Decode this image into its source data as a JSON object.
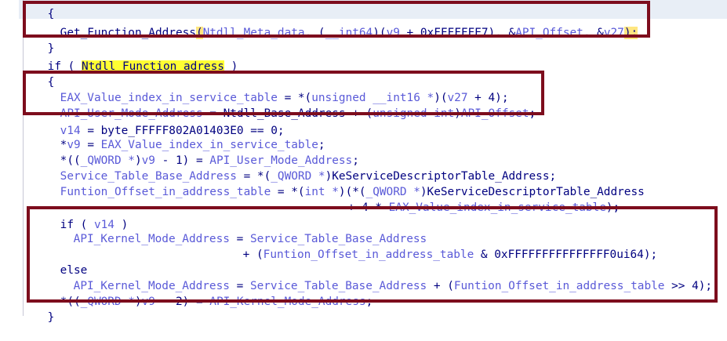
{
  "code": {
    "l0_open": "{",
    "l1": {
      "fn": "Get_Function_Address",
      "p1": "(",
      "a1": "Ntdll_Meta_data",
      "p2": ", (",
      "t1": "__int64",
      "p3": ")(",
      "a2": "v9",
      "p4": " + 0xFFFFFFE7), &",
      "a3": "API_Offset",
      "p5": ", &",
      "a4": "v27",
      "p6": ");"
    },
    "l2_close": "}",
    "l3": {
      "kw": "if ( ",
      "hl": "Ntdll_Function_adress",
      "end": " )"
    },
    "l4_open": "{",
    "l5": {
      "a": "EAX_Value_index_in_service_table",
      "b": " = *(",
      "t": "unsigned __int16 *",
      "c": ")(",
      "d": "v27",
      "e": " + 4);"
    },
    "l6": {
      "a": "API_User_Mode_Address",
      "b": " = ",
      "g": "Ntdll_Base_Address",
      "c": " + (",
      "t": "unsigned int",
      "d": ")",
      "e": "API_Offset",
      "f": ";"
    },
    "l7": {
      "a": "v14",
      "b": " = byte_FFFFF802A01403E0 == 0;"
    },
    "l8": {
      "a": "*",
      "b": "v9",
      "c": " = ",
      "d": "EAX_Value_index_in_service_table",
      "e": ";"
    },
    "l9": {
      "a": "*((",
      "t": "_QWORD *",
      "b": ")",
      "c": "v9",
      "d": " - 1) = ",
      "e": "API_User_Mode_Address",
      "f": ";"
    },
    "l10": {
      "a": "Service_Table_Base_Address",
      "b": " = *(",
      "t": "_QWORD *",
      "c": ")",
      "g": "KeServiceDescriptorTable_Address",
      "d": ";"
    },
    "l11": {
      "a": "Funtion_Offset_in_address_table",
      "b": " = *(",
      "t1": "int *",
      "c": ")(*(",
      "t2": "_QWORD *",
      "d": ")",
      "g": "KeServiceDescriptorTable_Address"
    },
    "l12": {
      "a": "+ 4 * ",
      "b": "EAX_Value_index_in_service_table",
      "c": ");"
    },
    "l13": {
      "a": "if ( ",
      "b": "v14",
      "c": " )"
    },
    "l14": {
      "a": "API_Kernel_Mode_Address",
      "b": " = ",
      "c": "Service_Table_Base_Address"
    },
    "l15": {
      "a": "+ (",
      "b": "Funtion_Offset_in_address_table",
      "c": " & 0xFFFFFFFFFFFFFFF0ui64);"
    },
    "l16": "else",
    "l17": {
      "a": "API_Kernel_Mode_Address",
      "b": " = ",
      "c": "Service_Table_Base_Address",
      "d": " + (",
      "e": "Funtion_Offset_in_address_table",
      "f": " >> 4);"
    },
    "l18": {
      "a": "*((",
      "t": "_QWORD *",
      "b": ")",
      "c": "v9",
      "d": " - 2) = ",
      "e": "API_Kernel_Mode_Address",
      "f": ";"
    },
    "l19_close": "}"
  },
  "colors": {
    "highlight_box": "#7d0d1d",
    "highlight_text_bg": "#ffff33",
    "identifier": "#000080",
    "local_variable": "#5a5ad8"
  }
}
